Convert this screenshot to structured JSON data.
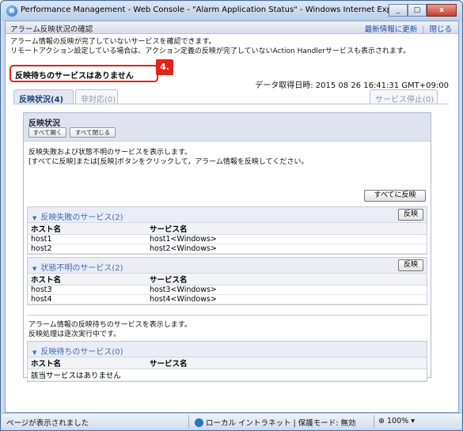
{
  "window": {
    "title": "Performance Management - Web Console - \"Alarm Application Status\" - Windows Internet Explorer",
    "minimize": "_",
    "maximize": "□",
    "close": "x"
  },
  "header": {
    "title": "アラーム反映状況の確認",
    "refresh_link": "最新情報に更新",
    "separator": "|",
    "close_link": "閉じる"
  },
  "info": {
    "line1": "アラーム情報の反映が完了していないサービスを確認できます。",
    "line2": "リモートアクション設定している場合は、アクション定義の反映が完了していないAction Handlerサービスも表示されます。"
  },
  "callout": {
    "text": "反映待ちのサービスはありません",
    "badge": "4."
  },
  "timestamp": "データ取得日時: 2015 08 26 16:41:31 GMT+09:00",
  "tabs": {
    "active": "反映状況(4)",
    "unsupported": "非対応(0)",
    "stopped": "サービス停止(0)"
  },
  "panel": {
    "title": "反映状況",
    "expand_all": "すべて開く",
    "collapse_all": "すべて閉じる",
    "desc_line1": "反映失敗および状態不明のサービスを表示します。",
    "desc_line2": "[すべてに反映]または[反映]ボタンをクリックして，アラーム情報を反映してください。",
    "apply_all": "すべてに反映",
    "failed": {
      "title": "反映失敗のサービス(2)",
      "apply": "反映",
      "col_host": "ホスト名",
      "col_service": "サービス名",
      "rows": [
        {
          "host": "host1",
          "service": "host1<Windows>"
        },
        {
          "host": "host2",
          "service": "host2<Windows>"
        }
      ]
    },
    "unknown": {
      "title": "状態不明のサービス(2)",
      "apply": "反映",
      "col_host": "ホスト名",
      "col_service": "サービス名",
      "rows": [
        {
          "host": "host3",
          "service": "host3<Windows>"
        },
        {
          "host": "host4",
          "service": "host4<Windows>"
        }
      ]
    },
    "pending_desc_line1": "アラーム情報の反映待ちのサービスを表示します。",
    "pending_desc_line2": "反映処理は逐次実行中です。",
    "pending": {
      "title": "反映待ちのサービス(0)",
      "col_host": "ホスト名",
      "col_service": "サービス名",
      "empty": "該当サービスはありません"
    }
  },
  "statusbar": {
    "left": "ページが表示されました",
    "zone": "ローカル イントラネット | 保護モード: 無効",
    "zoom": "100%"
  }
}
